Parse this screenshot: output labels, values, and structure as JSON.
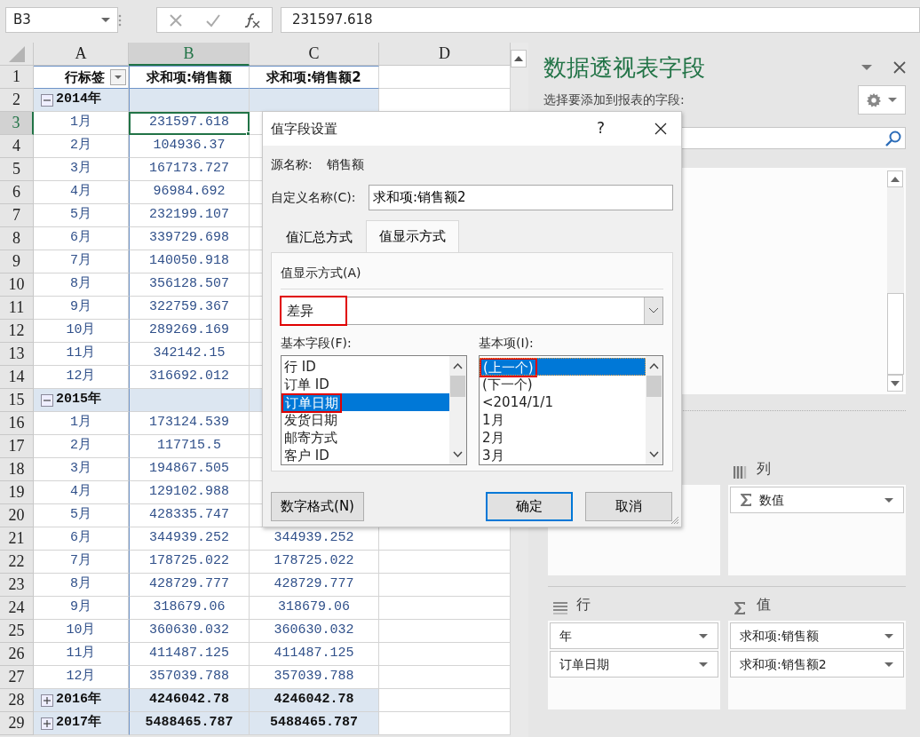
{
  "formula_bar": {
    "name_box": "B3",
    "formula": "231597.618"
  },
  "sheet": {
    "columns": [
      {
        "label": "A",
        "selected": false
      },
      {
        "label": "B",
        "selected": true
      },
      {
        "label": "C",
        "selected": false
      },
      {
        "label": "D",
        "selected": false
      }
    ],
    "rows": [
      {
        "number": "1",
        "kind": "header",
        "selected": false,
        "a": "行标签",
        "b": "求和项:销售额",
        "c": "求和项:销售额2"
      },
      {
        "number": "2",
        "kind": "year",
        "selected": false,
        "expanded": true,
        "a": "2014年"
      },
      {
        "number": "3",
        "kind": "month",
        "selected": true,
        "a": "1月",
        "b": "231597.618"
      },
      {
        "number": "4",
        "kind": "month",
        "selected": false,
        "a": "2月",
        "b": "104936.37"
      },
      {
        "number": "5",
        "kind": "month",
        "selected": false,
        "a": "3月",
        "b": "167173.727"
      },
      {
        "number": "6",
        "kind": "month",
        "selected": false,
        "a": "4月",
        "b": "96984.692"
      },
      {
        "number": "7",
        "kind": "month",
        "selected": false,
        "a": "5月",
        "b": "232199.107"
      },
      {
        "number": "8",
        "kind": "month",
        "selected": false,
        "a": "6月",
        "b": "339729.698"
      },
      {
        "number": "9",
        "kind": "month",
        "selected": false,
        "a": "7月",
        "b": "140050.918"
      },
      {
        "number": "10",
        "kind": "month",
        "selected": false,
        "a": "8月",
        "b": "356128.507"
      },
      {
        "number": "11",
        "kind": "month",
        "selected": false,
        "a": "9月",
        "b": "322759.367"
      },
      {
        "number": "12",
        "kind": "month",
        "selected": false,
        "a": "10月",
        "b": "289269.169"
      },
      {
        "number": "13",
        "kind": "month",
        "selected": false,
        "a": "11月",
        "b": "342142.15"
      },
      {
        "number": "14",
        "kind": "month",
        "selected": false,
        "a": "12月",
        "b": "316692.012"
      },
      {
        "number": "15",
        "kind": "year",
        "selected": false,
        "expanded": true,
        "a": "2015年"
      },
      {
        "number": "16",
        "kind": "month",
        "selected": false,
        "a": "1月",
        "b": "173124.539"
      },
      {
        "number": "17",
        "kind": "month",
        "selected": false,
        "a": "2月",
        "b": "117715.5"
      },
      {
        "number": "18",
        "kind": "month",
        "selected": false,
        "a": "3月",
        "b": "194867.505"
      },
      {
        "number": "19",
        "kind": "month",
        "selected": false,
        "a": "4月",
        "b": "129102.988"
      },
      {
        "number": "20",
        "kind": "month",
        "selected": false,
        "a": "5月",
        "b": "428335.747"
      },
      {
        "number": "21",
        "kind": "month",
        "selected": false,
        "a": "6月",
        "b": "344939.252",
        "c": "344939.252"
      },
      {
        "number": "22",
        "kind": "month",
        "selected": false,
        "a": "7月",
        "b": "178725.022",
        "c": "178725.022"
      },
      {
        "number": "23",
        "kind": "month",
        "selected": false,
        "a": "8月",
        "b": "428729.777",
        "c": "428729.777"
      },
      {
        "number": "24",
        "kind": "month",
        "selected": false,
        "a": "9月",
        "b": "318679.06",
        "c": "318679.06"
      },
      {
        "number": "25",
        "kind": "month",
        "selected": false,
        "a": "10月",
        "b": "360630.032",
        "c": "360630.032"
      },
      {
        "number": "26",
        "kind": "month",
        "selected": false,
        "a": "11月",
        "b": "411487.125",
        "c": "411487.125"
      },
      {
        "number": "27",
        "kind": "month",
        "selected": false,
        "a": "12月",
        "b": "357039.788",
        "c": "357039.788"
      },
      {
        "number": "28",
        "kind": "year",
        "selected": false,
        "expanded": false,
        "a": "2016年",
        "b": "4246042.78",
        "c": "4246042.78"
      },
      {
        "number": "29",
        "kind": "year",
        "selected": false,
        "expanded": false,
        "a": "2017年",
        "b": "5488465.787",
        "c": "5488465.787"
      }
    ]
  },
  "dialog": {
    "title": "值字段设置",
    "help": "?",
    "source_label": "源名称:",
    "source_value": "销售额",
    "custom_name_label": "自定义名称(C):",
    "custom_name": "求和项:销售额2",
    "tabs": [
      {
        "label": "值汇总方式",
        "selected": false
      },
      {
        "label": "值显示方式",
        "selected": true
      }
    ],
    "show_as_label": "值显示方式(A)",
    "show_as": {
      "value": "差异",
      "highlighted": true
    },
    "base_field_label": "基本字段(F):",
    "base_fields": [
      {
        "label": "行 ID",
        "selected": false,
        "highlighted": false
      },
      {
        "label": "订单 ID",
        "selected": false,
        "highlighted": false
      },
      {
        "label": "订单日期",
        "selected": true,
        "highlighted": true
      },
      {
        "label": "发货日期",
        "selected": false,
        "highlighted": false
      },
      {
        "label": "邮寄方式",
        "selected": false,
        "highlighted": false
      },
      {
        "label": "客户 ID",
        "selected": false,
        "highlighted": false
      }
    ],
    "base_item_label": "基本项(I):",
    "base_items": [
      {
        "label": "(上一个)",
        "selected": true,
        "highlighted": true
      },
      {
        "label": "(下一个)",
        "selected": false,
        "highlighted": false
      },
      {
        "label": "<2014/1/1",
        "selected": false,
        "highlighted": false
      },
      {
        "label": "1月",
        "selected": false,
        "highlighted": false
      },
      {
        "label": "2月",
        "selected": false,
        "highlighted": false
      },
      {
        "label": "3月",
        "selected": false,
        "highlighted": false
      }
    ],
    "buttons": [
      {
        "label": "数字格式(N)",
        "kind": "normal"
      },
      {
        "label": "确定",
        "kind": "default"
      },
      {
        "label": "取消",
        "kind": "normal"
      }
    ]
  },
  "field_pane": {
    "title": "数据透视表字段",
    "subtitle": "选择要添加到报表的字段:",
    "areas": [
      {
        "kind": "filters"
      },
      {
        "kind": "columns",
        "label": "列",
        "fields": [
          {
            "label": "数值",
            "kind": "values"
          }
        ]
      },
      {
        "kind": "rows",
        "label": "行",
        "fields": [
          {
            "label": "年",
            "kind": "field"
          },
          {
            "label": "订单日期",
            "kind": "field"
          }
        ]
      },
      {
        "kind": "values",
        "label": "值",
        "fields": [
          {
            "label": "求和项:销售额",
            "kind": "field"
          },
          {
            "label": "求和项:销售额2",
            "kind": "field"
          }
        ]
      }
    ]
  }
}
